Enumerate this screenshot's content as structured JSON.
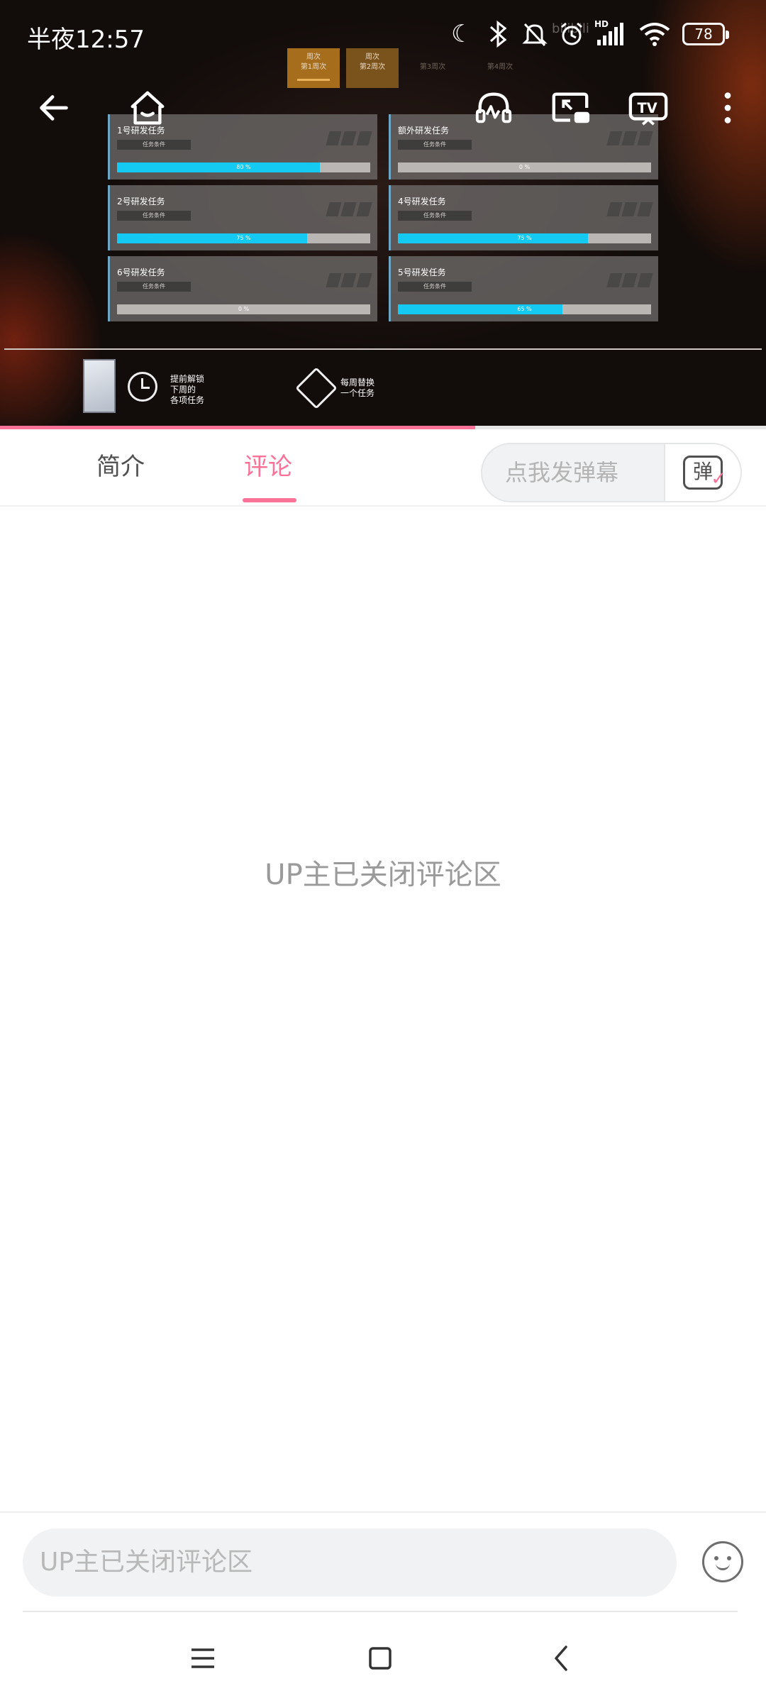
{
  "status_bar": {
    "time": "半夜12:57",
    "battery": "78",
    "icons": [
      "moon-icon",
      "bluetooth-icon",
      "bell-off-icon",
      "alarm-icon",
      "signal-hd-icon",
      "wifi-icon",
      "battery-icon"
    ]
  },
  "video": {
    "watermark": "bilibili",
    "week_tabs": [
      {
        "top": "周次",
        "label": "第1周次"
      },
      {
        "top": "周次",
        "label": "第2周次"
      },
      {
        "top": "",
        "label": "第3周次"
      },
      {
        "top": "",
        "label": "第4周次"
      }
    ],
    "tasks": [
      {
        "title": "1号研发任务",
        "tag": "任务条件",
        "percent_label": "80 %",
        "progress": 0.8
      },
      {
        "title": "额外研发任务",
        "tag": "任务条件",
        "percent_label": "0 %",
        "progress": 0.0
      },
      {
        "title": "2号研发任务",
        "tag": "任务条件",
        "percent_label": "75 %",
        "progress": 0.75
      },
      {
        "title": "4号研发任务",
        "tag": "任务条件",
        "percent_label": "75 %",
        "progress": 0.75
      },
      {
        "title": "6号研发任务",
        "tag": "任务条件",
        "percent_label": "0 %",
        "progress": 0.0
      },
      {
        "title": "5号研发任务",
        "tag": "任务条件",
        "percent_label": "65 %",
        "progress": 0.65
      }
    ],
    "unlock_text": "提前解锁\n下周的\n各项任务",
    "swap_text": "每周替换\n一个任务",
    "playback_progress": 0.62
  },
  "player_controls": [
    "back-arrow-icon",
    "home-icon",
    "audio-mode-icon",
    "picture-in-picture-icon",
    "tv-cast-icon",
    "more-vertical-icon"
  ],
  "tabs": {
    "intro": "简介",
    "comments": "评论",
    "active": "comments"
  },
  "danmaku": {
    "placeholder": "点我发弹幕",
    "button_glyph": "弹"
  },
  "content": {
    "closed_message": "UP主已关闭评论区"
  },
  "bottom_input": {
    "placeholder": "UP主已关闭评论区"
  },
  "accent_color": "#fb7299"
}
